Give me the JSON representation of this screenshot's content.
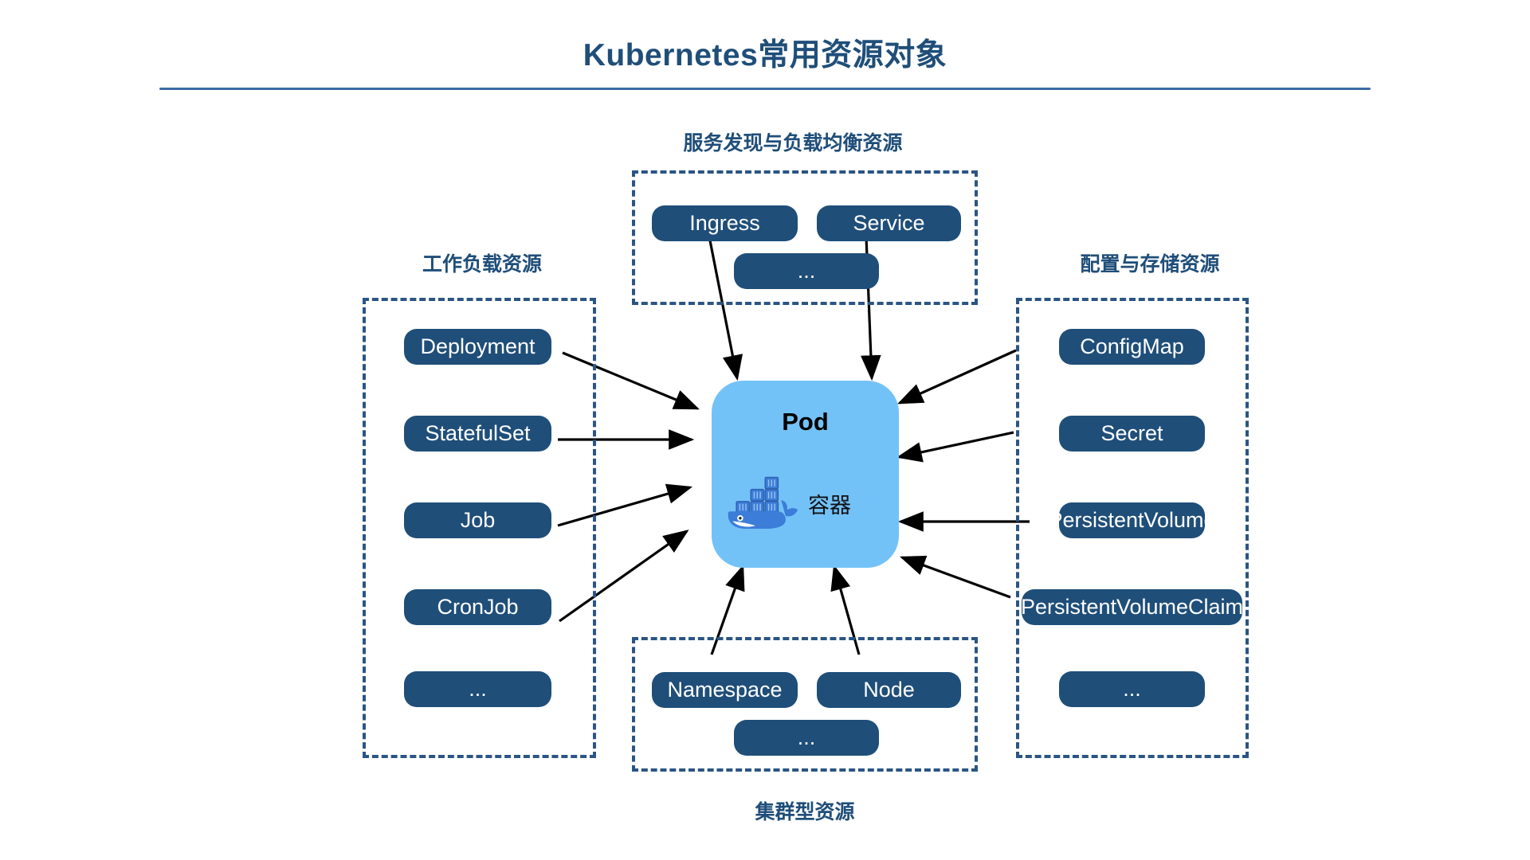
{
  "header": {
    "title": "Kubernetes常用资源对象"
  },
  "groups": {
    "workload": {
      "label": "工作负载资源",
      "items": [
        "Deployment",
        "StatefulSet",
        "Job",
        "CronJob",
        "..."
      ]
    },
    "service": {
      "label": "服务发现与负载均衡资源",
      "items": [
        "Ingress",
        "Service",
        "..."
      ]
    },
    "config_storage": {
      "label": "配置与存储资源",
      "items": [
        "ConfigMap",
        "Secret",
        "PersistentVolume",
        "PersistentVolumeClaim",
        "..."
      ]
    },
    "cluster": {
      "label": "集群型资源",
      "items": [
        "Namespace",
        "Node",
        "..."
      ]
    }
  },
  "pod": {
    "title": "Pod",
    "container_label": "容器",
    "container_icon": "docker-whale-icon"
  },
  "colors": {
    "title_blue": "#1F4E79",
    "rule_blue": "#3C6BA5",
    "pill_blue": "#1F4E79",
    "pill_text": "#FFFFFF",
    "dashed_border": "#2A5584",
    "pod_fill": "#73C2F7",
    "whale_blue": "#3C7DD9",
    "arrow_black": "#000000",
    "background": "#FFFFFF"
  }
}
